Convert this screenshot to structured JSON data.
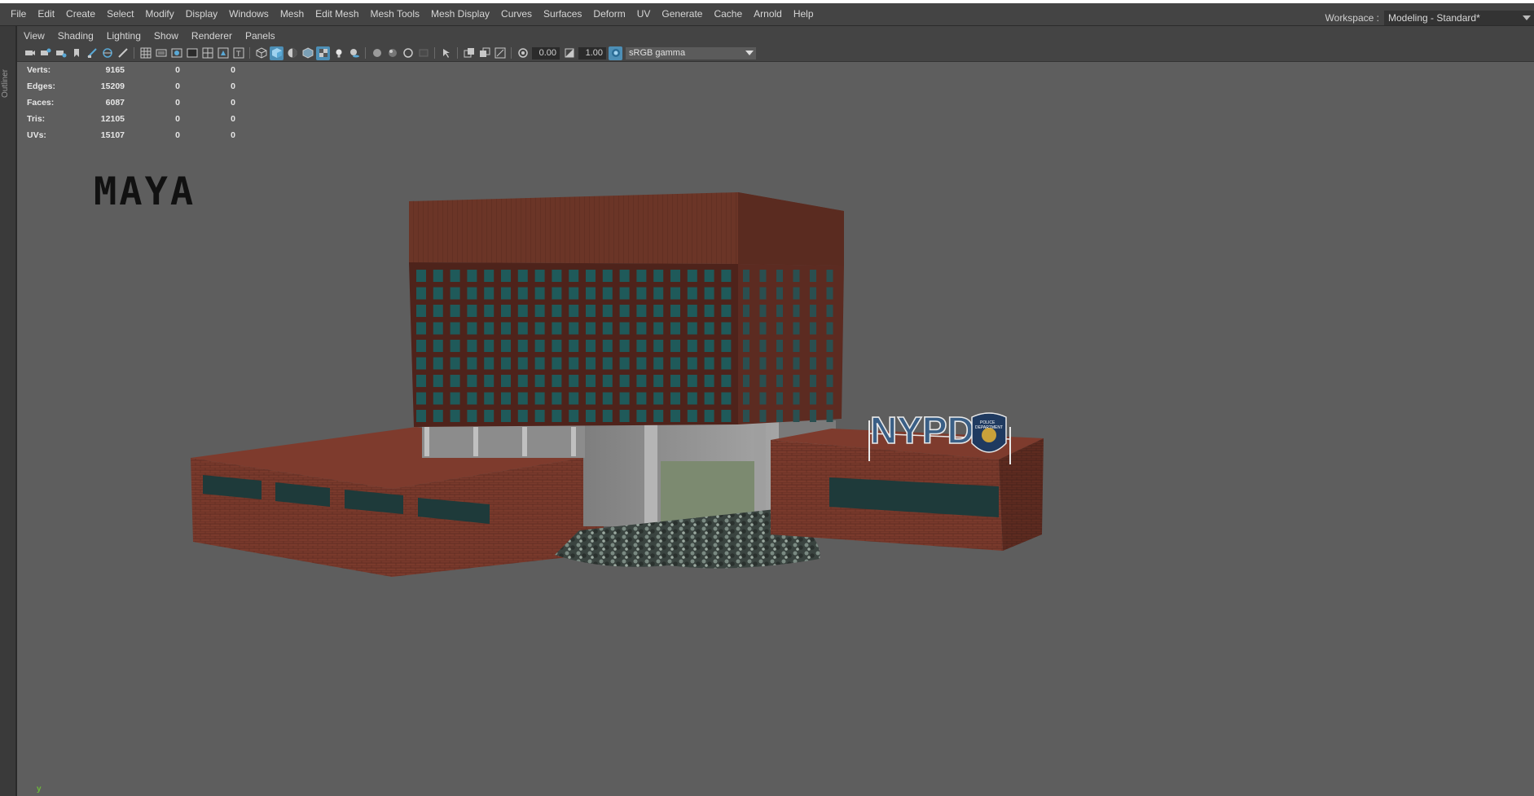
{
  "menubar": {
    "items": [
      "File",
      "Edit",
      "Create",
      "Select",
      "Modify",
      "Display",
      "Windows",
      "Mesh",
      "Edit Mesh",
      "Mesh Tools",
      "Mesh Display",
      "Curves",
      "Surfaces",
      "Deform",
      "UV",
      "Generate",
      "Cache",
      "Arnold",
      "Help"
    ],
    "workspace_label": "Workspace :",
    "workspace_value": "Modeling - Standard*"
  },
  "outliner": {
    "label": "Outliner"
  },
  "panel_menu": {
    "items": [
      "View",
      "Shading",
      "Lighting",
      "Show",
      "Renderer",
      "Panels"
    ]
  },
  "toolbar": {
    "icons": [
      "camera-select-icon",
      "camera-attributes-icon",
      "bookmark-icon",
      "image-plane-icon",
      "grease-pencil-icon",
      "grid-icon",
      "film-gate-icon",
      "resolution-gate-icon",
      "gate-mask-icon",
      "field-chart-icon",
      "safe-action-icon",
      "safe-title-icon",
      "wireframe-icon",
      "smooth-shade-icon",
      "default-material-icon",
      "xray-icon",
      "use-lights-icon",
      "shadows-icon",
      "ambient-occlusion-icon",
      "antialiasing-icon",
      "depth-of-field-icon",
      "isolate-select-icon",
      "xray-joints-icon",
      "xray-active-icon",
      "backface-icon",
      "exposure-icon",
      "gamma-icon",
      "color-management-icon"
    ],
    "exposure": "0.00",
    "gamma": "1.00",
    "colorspace": "sRGB gamma"
  },
  "hud": {
    "rows": [
      {
        "label": "Verts:",
        "v1": "9165",
        "v2": "0",
        "v3": "0"
      },
      {
        "label": "Edges:",
        "v1": "15209",
        "v2": "0",
        "v3": "0"
      },
      {
        "label": "Faces:",
        "v1": "6087",
        "v2": "0",
        "v3": "0"
      },
      {
        "label": "Tris:",
        "v1": "12105",
        "v2": "0",
        "v3": "0"
      },
      {
        "label": "UVs:",
        "v1": "15107",
        "v2": "0",
        "v3": "0"
      }
    ]
  },
  "viewport": {
    "logo_text": "MAYA",
    "sign_text": "NYPD",
    "badge_lines": [
      "POLICE",
      "DEPARTMENT"
    ],
    "axis_label": "y"
  },
  "colors": {
    "brick": "#7a3a2c",
    "brick_dark": "#5a271d",
    "roof": "#6b3527",
    "window": "#1f5a5a",
    "concrete": "#8e8e8e",
    "accent": "#4d8fb6"
  }
}
